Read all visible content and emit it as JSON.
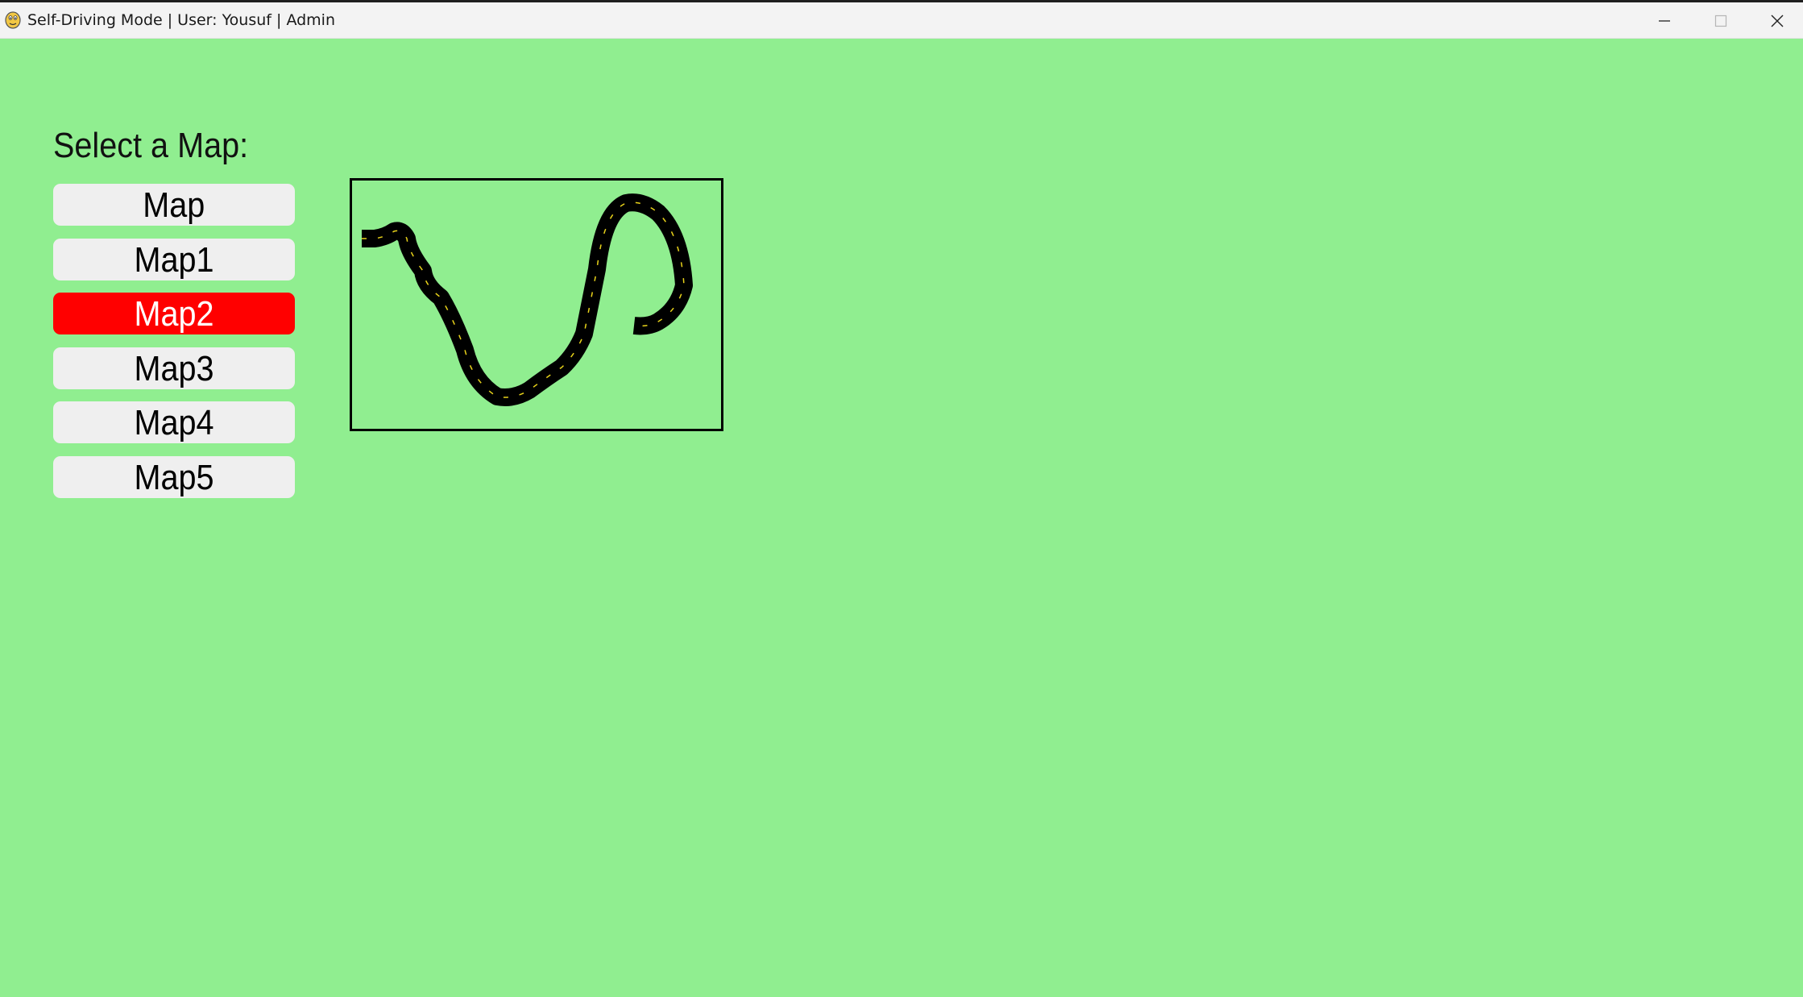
{
  "window": {
    "title": "Self-Driving Mode | User: Yousuf | Admin",
    "icon": "pygame-snake-icon",
    "controls": [
      "minimize-icon",
      "maximize-icon",
      "close-icon"
    ]
  },
  "map_selector": {
    "heading": "Select a Map:",
    "options": [
      {
        "label": "Map",
        "selected": false
      },
      {
        "label": "Map1",
        "selected": false
      },
      {
        "label": "Map2",
        "selected": true
      },
      {
        "label": "Map3",
        "selected": false
      },
      {
        "label": "Map4",
        "selected": false
      },
      {
        "label": "Map5",
        "selected": false
      }
    ]
  },
  "preview": {
    "selected_map": "Map2"
  },
  "colors": {
    "background": "#90ee90",
    "button": "#efefef",
    "selected_button": "#ff0000",
    "selected_text": "#ffffff",
    "road": "#000000",
    "lane_marking": "#e8d21a"
  }
}
